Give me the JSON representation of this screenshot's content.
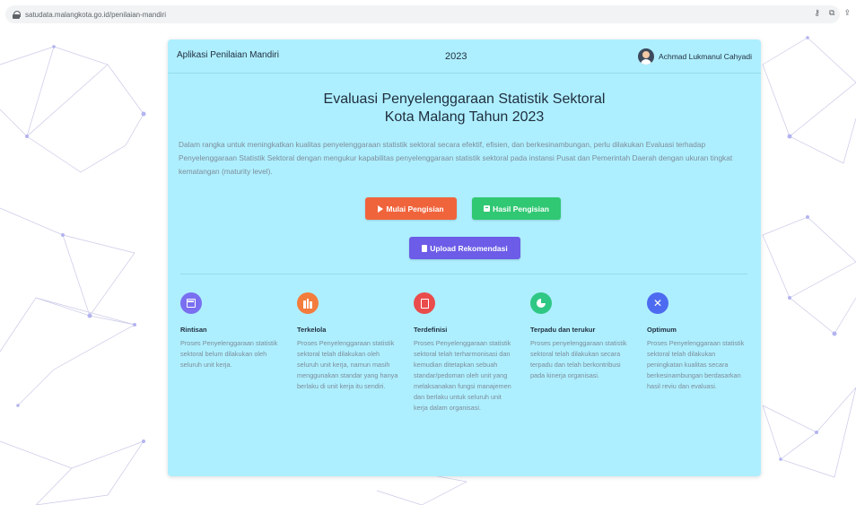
{
  "browser": {
    "url": "satudata.malangkota.go.id/penilaian-mandiri",
    "icons": [
      "key-icon",
      "translate-icon",
      "share-icon"
    ]
  },
  "header": {
    "app_name": "Aplikasi Penilaian Mandiri",
    "year": "2023",
    "user_name": "Achmad Lukmanul Cahyadi"
  },
  "main": {
    "title_line1": "Evaluasi Penyelenggaraan Statistik Sektoral",
    "title_line2": "Kota Malang Tahun 2023",
    "description": "Dalam rangka untuk meningkatkan kualitas penyelenggaraan statistik sektoral secara efektif, efisien, dan berkesinambungan, perlu dilakukan Evaluasi terhadap Penyelenggaraan Statistik Sektoral dengan mengukur kapabilitas penyelenggaraan statistik sektoral pada instansi Pusat dan Pemerintah Daerah dengan ukuran tingkat kematangan (maturity level).",
    "buttons": {
      "mulai": "Mulai Pengisian",
      "hasil": "Hasil Pengisian",
      "upload": "Upload Rekomendasi"
    }
  },
  "levels": [
    {
      "name": "Rintisan",
      "icon": "calendar-icon",
      "color": "#7a6ff0",
      "desc": "Proses Penyelenggaraan statistik sektoral belum dilakukan oleh seluruh unit kerja."
    },
    {
      "name": "Terkelola",
      "icon": "books-icon",
      "color": "#f47c3c",
      "desc": "Proses Penyelenggaraan statistik sektoral telah dilakukan oleh seluruh unit kerja, namun masih menggunakan standar yang hanya berlaku di unit kerja itu sendiri."
    },
    {
      "name": "Terdefinisi",
      "icon": "book-icon",
      "color": "#ea4c4c",
      "desc": "Proses Penyelenggaraan statistik sektoral telah terharmonisasi dan kemudian ditetapkan sebuah standar/pedoman oleh unit yang melaksanakan fungsi manajemen dan berlaku untuk seluruh unit kerja dalam organisasi."
    },
    {
      "name": "Terpadu dan terukur",
      "icon": "pie-chart-icon",
      "color": "#2fc784",
      "desc": "Proses penyelenggaraan statistik sektoral telah dilakukan secara terpadu dan telah berkontribusi pada kinerja organisasi."
    },
    {
      "name": "Optimum",
      "icon": "tools-icon",
      "color": "#4d6bf0",
      "desc": "Proses Penyelenggaraan statistik sektoral telah dilakukan peningkatan kualitas secara berkesinambungan berdasarkan hasil reviu dan evaluasi."
    }
  ]
}
